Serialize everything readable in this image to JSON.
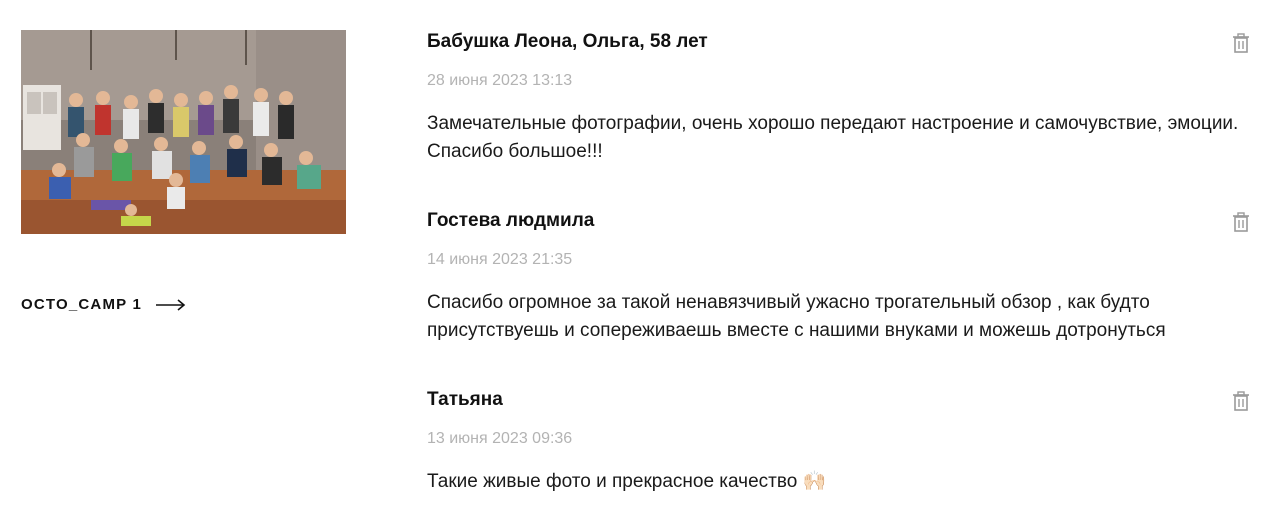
{
  "album": {
    "title": "OCTO_CAMP 1",
    "photo_alt": "group photo of children at camp"
  },
  "comments": [
    {
      "author": "Бабушка Леона, Ольга, 58 лет",
      "date": "28 июня 2023 13:13",
      "text": "Замечательные фотографии, очень хорошо передают настроение и самочувствие, эмоции. Спасибо большое!!!"
    },
    {
      "author": "Гостева людмила",
      "date": "14 июня 2023 21:35",
      "text": "Спасибо огромное за такой ненавязчивый ужасно трогательный обзор , как будто присутствуешь и сопереживаешь вместе с нашими внуками и можешь дотронуться"
    },
    {
      "author": "Татьяна",
      "date": "13 июня 2023 09:36",
      "text": "Такие живые фото и прекрасное качество 🙌🏻"
    }
  ],
  "icons": {
    "delete": "trash-icon",
    "album_link": "arrow-right-icon"
  },
  "colors": {
    "date_text": "#b3b3b3",
    "icon": "#9a9a9a"
  }
}
